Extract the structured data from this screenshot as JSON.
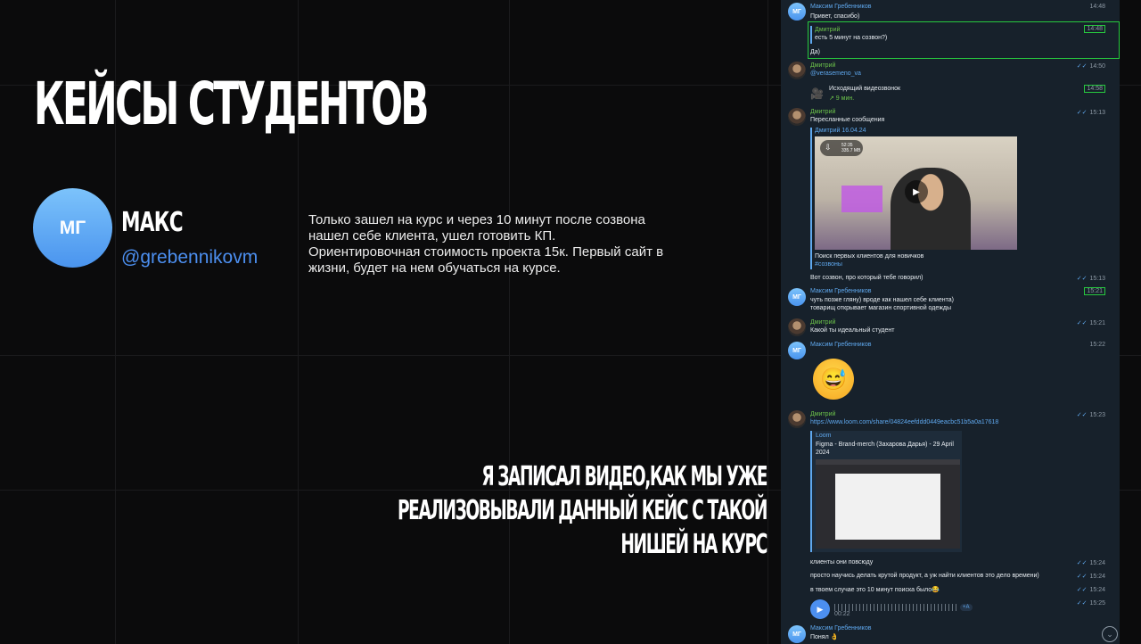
{
  "slide": {
    "headline": "КЕЙСЫ СТУДЕНТОВ",
    "avatar_initials": "МГ",
    "user_name": "МАКС",
    "user_handle": "@grebennikovm",
    "testimonial": "Только зашел на курс и через 10 минут после созвона нашел себе клиента, ушел готовить КП. Ориентировочная стоимость проекта 15к. Первый сайт в жизни, будет на нем обучаться на курсе.",
    "bottom_line1": "Я ЗАПИСАЛ ВИДЕО,КАК МЫ УЖЕ",
    "bottom_line2": "РЕАЛИЗОВЫВАЛИ ДАННЫЙ КЕЙС С ТАКОЙ",
    "bottom_line3": "НИШЕЙ НА КУРС"
  },
  "chat": {
    "m1": {
      "sender": "Максим Гребенников",
      "text": "Привет, спасибо)",
      "time": "14:48"
    },
    "m2": {
      "reply_sender": "Дмитрий",
      "reply_text": "есть 5 минут на созвон?)",
      "time": "14:48",
      "text": "Да)"
    },
    "m3": {
      "sender": "Дмитрий",
      "text": "@verasemeno_va",
      "time": "14:50"
    },
    "call": {
      "title": "Исходящий видеозвонок",
      "duration": "↗ 9 мин.",
      "time": "14:58"
    },
    "m4": {
      "sender": "Дмитрий",
      "forwarded": "Пересланные сообщения",
      "time": "15:13",
      "fwd_header": "Дмитрий 16.04.24",
      "dl_time": "52:35",
      "dl_size": "335.7 MB",
      "video_caption": "Поиск первых клиентов для новичков",
      "video_tag": "#созвоны"
    },
    "m5": {
      "text": "Вот созвон, про который тебе говорил)",
      "time": "15:13"
    },
    "m6": {
      "sender": "Максим Гребенников",
      "line1": "чуть позже гляну) вроде как нашел себе клиента)",
      "line2": "товарищ открывает магазин спортивной одежды",
      "time": "15:21"
    },
    "m7": {
      "sender": "Дмитрий",
      "text": "Какой ты идеальный студент",
      "time": "15:21"
    },
    "m8": {
      "sender": "Максим Гребенников",
      "time": "15:22",
      "emoji": "😅"
    },
    "m9": {
      "sender": "Дмитрий",
      "link": "https://www.loom.com/share/04824eefddd0449eacbc51b5a0a17618",
      "time": "15:23",
      "card_site": "Loom",
      "card_title": "Figma - Brand-merch (Захарова Дарья) - 29 April 2024"
    },
    "m10": {
      "text": "клиенты они повсюду",
      "time": "15:24"
    },
    "m11": {
      "text": "просто научись делать крутой продукт, а уж найти клиентов это дело времени)",
      "time": "15:24"
    },
    "m12": {
      "text": "в твоем случае это 10 минут поиска было😂",
      "time": "15:24"
    },
    "voice": {
      "duration": "00:22",
      "time": "15:25",
      "badge": "+A"
    },
    "m13": {
      "sender": "Максим Гребенников",
      "text": "Понял 👌"
    },
    "check": "✓✓",
    "avatar_initials": "МГ"
  },
  "icons": {
    "play": "▶",
    "video_call": "🎥",
    "download": "⇩",
    "scroll_down": "⌄"
  }
}
